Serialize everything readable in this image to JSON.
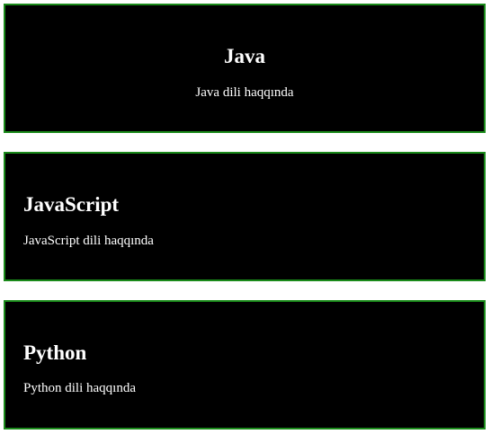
{
  "cards": [
    {
      "title": "Java",
      "description": "Java dili haqqında"
    },
    {
      "title": "JavaScript",
      "description": "JavaScript dili haqqında"
    },
    {
      "title": "Python",
      "description": "Python dili haqqında"
    }
  ],
  "colors": {
    "card_background": "#000000",
    "card_border": "#1a8a1a",
    "text": "#ffffff",
    "page_background": "#ffffff"
  }
}
